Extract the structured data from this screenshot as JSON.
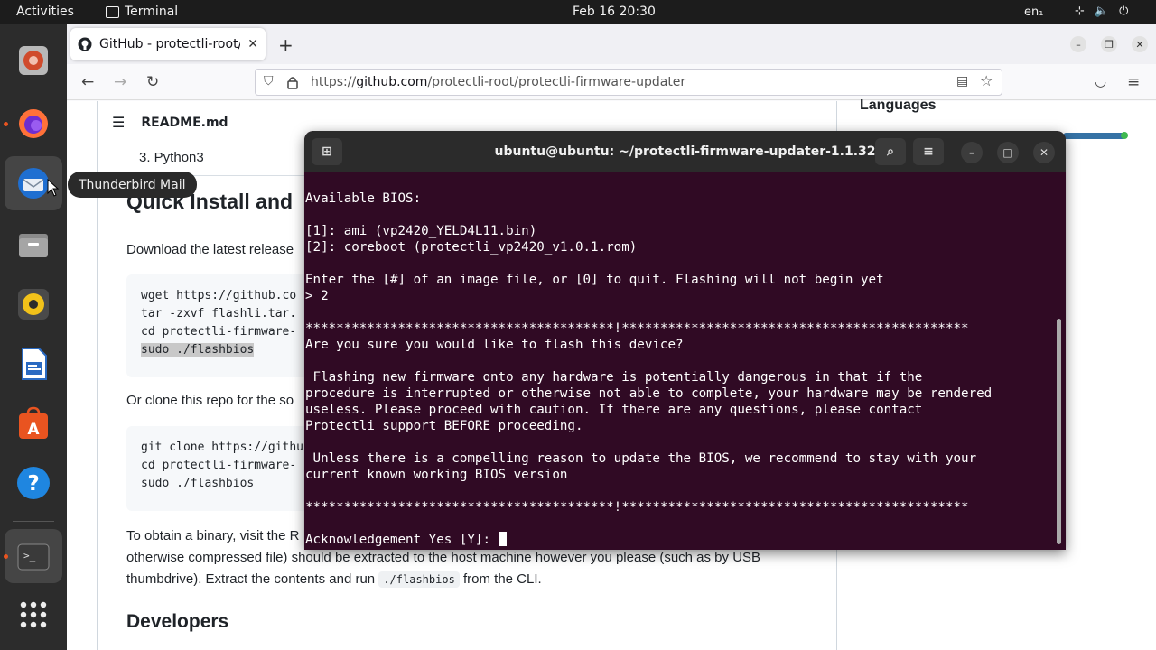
{
  "topbar": {
    "activities": "Activities",
    "app_name": "Terminal",
    "clock": "Feb 16  20:30",
    "lang": "en₁"
  },
  "tooltip": "Thunderbird Mail",
  "browser": {
    "tab_title": "GitHub - protectli-root/pr",
    "url_prefix": "https://",
    "url_host": "github.com",
    "url_path": "/protectli-root/protectli-firmware-updater"
  },
  "readme": {
    "file_name": "README.md",
    "list_item": "3. Python3",
    "heading_quick": "Quick Install and",
    "download_text": "Download the latest release",
    "code1": [
      "wget https://github.co",
      "tar -zxvf flashli.tar.",
      "cd protectli-firmware-",
      "sudo ./flashbios"
    ],
    "clone_text": "Or clone this repo for the so",
    "code2": [
      "git clone https://githu",
      "cd protectli-firmware-",
      "sudo ./flashbios"
    ],
    "binary_line1": "To obtain a binary, visit the R",
    "binary_line2": "otherwise compressed file) should be extracted to the host machine however you please (such as by USB",
    "binary_line3_a": "thumbdrive). Extract the contents and run",
    "binary_line3_code": "./flashbios",
    "binary_line3_b": "from the CLI.",
    "heading_dev": "Developers"
  },
  "sidebar": {
    "languages": "Languages"
  },
  "terminal": {
    "title": "ubuntu@ubuntu: ~/protectli-firmware-updater-1.1.32",
    "lines": [
      "Available BIOS:",
      "",
      "[1]: ami (vp2420_YELD4L11.bin)",
      "[2]: coreboot (protectli_vp2420_v1.0.1.rom)",
      "",
      "Enter the [#] of an image file, or [0] to quit. Flashing will not begin yet",
      "> 2",
      "",
      "****************************************!*********************************************",
      "Are you sure you would like to flash this device?",
      "",
      " Flashing new firmware onto any hardware is potentially dangerous in that if the",
      "procedure is interrupted or otherwise not able to complete, your hardware may be rendered",
      "useless. Please proceed with caution. If there are any questions, please contact",
      "Protectli support BEFORE proceeding.",
      "",
      " Unless there is a compelling reason to update the BIOS, we recommend to stay with your",
      "current known working BIOS version",
      "",
      "****************************************!*********************************************",
      "",
      "Acknowledgement Yes [Y]: "
    ]
  }
}
